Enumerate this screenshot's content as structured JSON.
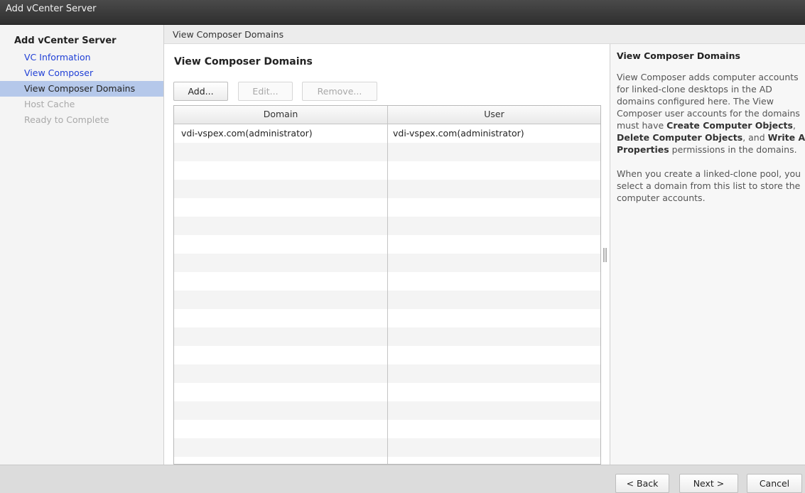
{
  "window": {
    "title": "Add vCenter Server"
  },
  "nav": {
    "title": "Add vCenter Server",
    "items": [
      {
        "label": "VC Information",
        "state": "link"
      },
      {
        "label": "View Composer",
        "state": "link"
      },
      {
        "label": "View Composer Domains",
        "state": "active"
      },
      {
        "label": "Host Cache",
        "state": "disabled"
      },
      {
        "label": "Ready to Complete",
        "state": "disabled"
      }
    ]
  },
  "breadcrumb": "View Composer Domains",
  "main": {
    "title": "View Composer Domains",
    "buttons": {
      "add": "Add...",
      "edit": "Edit...",
      "remove": "Remove..."
    },
    "table": {
      "columns": [
        "Domain",
        "User"
      ],
      "rows": [
        [
          "vdi-vspex.com(administrator)",
          "vdi-vspex.com(administrator)"
        ]
      ]
    }
  },
  "help": {
    "title": "View Composer Domains",
    "p1_a": "View Composer adds computer accounts for linked-clone desktops in the AD domains configured here. The View Composer user accounts for the domains must have ",
    "p1_b1": "Create Computer Objects",
    "p1_c": ", ",
    "p1_b2": "Delete Computer Objects",
    "p1_d": ", and ",
    "p1_b3": "Write All Properties",
    "p1_e": " permissions in the domains.",
    "p2": "When you create a linked-clone pool, you select a domain from this list to store the computer accounts."
  },
  "footer": {
    "back": "< Back",
    "next": "Next >",
    "cancel": "Cancel"
  }
}
